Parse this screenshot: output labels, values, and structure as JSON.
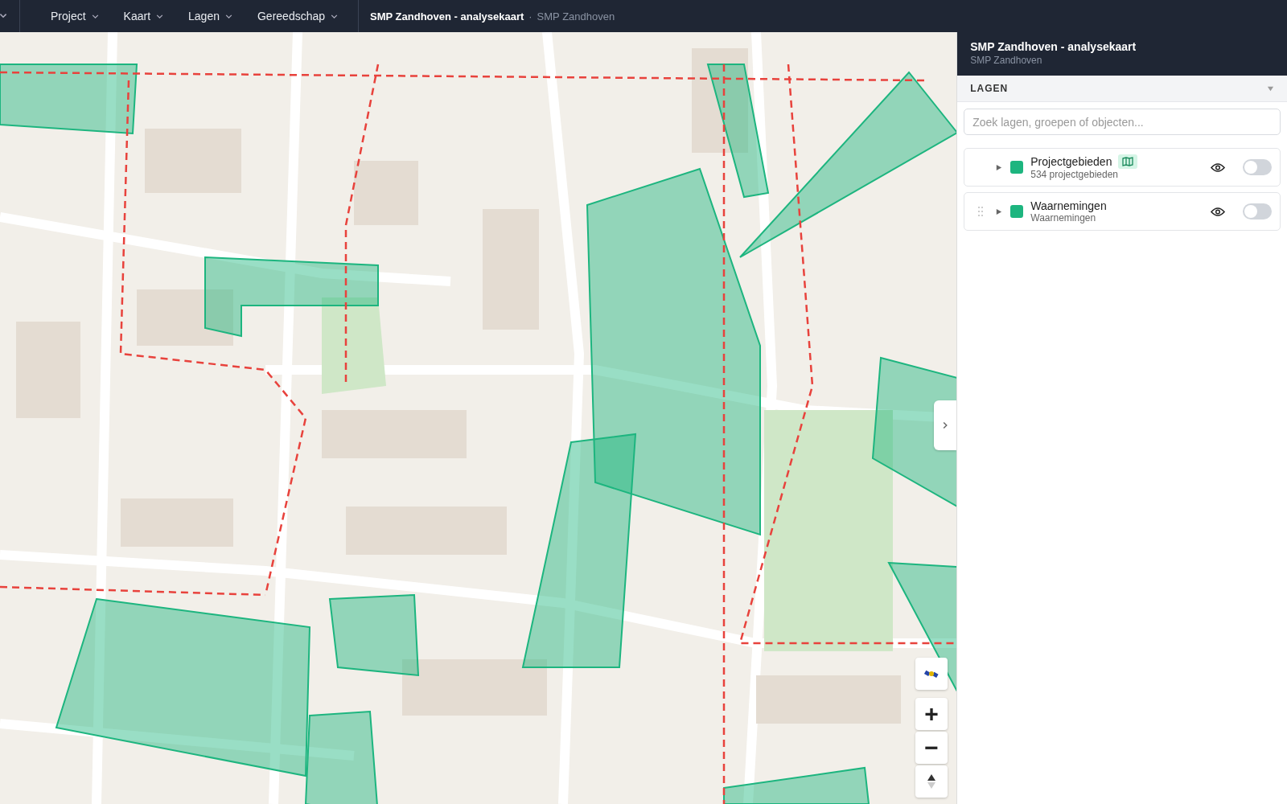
{
  "menu_bar": {
    "menus": [
      {
        "label": "Project"
      },
      {
        "label": "Kaart"
      },
      {
        "label": "Lagen"
      },
      {
        "label": "Gereedschap"
      }
    ],
    "title": "SMP Zandhoven - analysekaart",
    "separator": "·",
    "subtitle": "SMP Zandhoven"
  },
  "sidebar": {
    "title": "SMP Zandhoven - analysekaart",
    "subtitle": "SMP Zandhoven",
    "section": {
      "label": "LAGEN",
      "expanded": true
    },
    "search": {
      "placeholder": "Zoek lagen, groepen of objecten..."
    },
    "layers": [
      {
        "name": "Projectgebieden",
        "detail": "534 projectgebieden",
        "color": "#1db57f",
        "map_badge": true,
        "drag_handle": false,
        "on": false
      },
      {
        "name": "Waarnemingen",
        "detail": "Waarnemingen",
        "color": "#1db57f",
        "map_badge": false,
        "drag_handle": true,
        "on": false
      }
    ]
  },
  "map_controls": {
    "zoom_in": "+",
    "zoom_out": "−"
  }
}
